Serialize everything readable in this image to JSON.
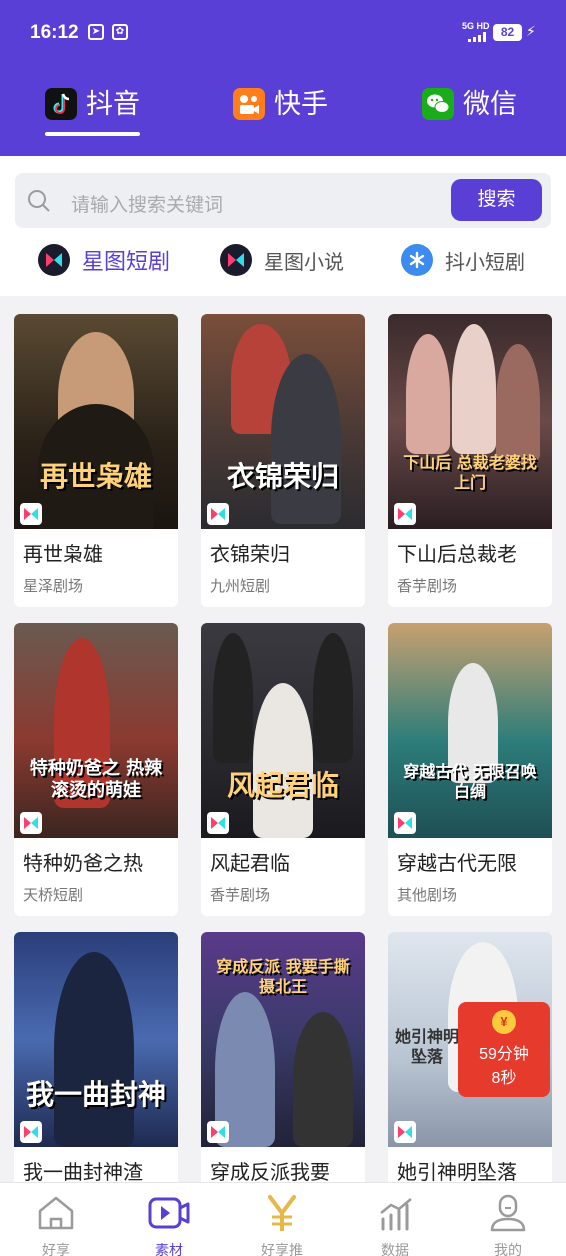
{
  "status_bar": {
    "time": "16:12",
    "network": "5G HD",
    "battery": "82",
    "icons": [
      "telegram-icon",
      "app-icon"
    ]
  },
  "platform_tabs": [
    {
      "label": "抖音",
      "icon": "douyin-icon",
      "active": true
    },
    {
      "label": "快手",
      "icon": "kuaishou-icon",
      "active": false
    },
    {
      "label": "微信",
      "icon": "wechat-icon",
      "active": false
    }
  ],
  "search": {
    "placeholder": "请输入搜索关键词",
    "button_label": "搜索"
  },
  "sub_tabs": [
    {
      "label": "星图短剧",
      "active": true
    },
    {
      "label": "星图小说",
      "active": false
    },
    {
      "label": "抖小短剧",
      "active": false
    }
  ],
  "cards": [
    {
      "title": "再世枭雄",
      "source": "星泽剧场",
      "poster_text": "再世枭雄"
    },
    {
      "title": "衣锦荣归",
      "source": "九州短剧",
      "poster_text": "衣锦荣归"
    },
    {
      "title": "下山后总裁老",
      "source": "香芋剧场",
      "poster_text": "下山后 总裁老婆找上门"
    },
    {
      "title": "特种奶爸之热",
      "source": "天桥短剧",
      "poster_text": "特种奶爸之 热辣滚烫的萌娃"
    },
    {
      "title": "风起君临",
      "source": "香芋剧场",
      "poster_text": "风起君临"
    },
    {
      "title": "穿越古代无限",
      "source": "其他剧场",
      "poster_text": "穿越古代 无限召唤白绸"
    },
    {
      "title": "我一曲封神渣",
      "source": "",
      "poster_text": "我一曲封神"
    },
    {
      "title": "穿成反派我要",
      "source": "",
      "poster_text": "穿成反派 我要手撕摄北王"
    },
    {
      "title": "她引神明坠落",
      "source": "",
      "poster_text": "她引神明坠落"
    }
  ],
  "red_packet": {
    "symbol": "¥",
    "line1": "59分钟",
    "line2": "8秒"
  },
  "bottom_nav": [
    {
      "label": "好享",
      "icon": "home-icon",
      "active": false
    },
    {
      "label": "素材",
      "icon": "video-icon",
      "active": true
    },
    {
      "label": "好享推",
      "icon": "yen-icon",
      "active": false
    },
    {
      "label": "数据",
      "icon": "chart-icon",
      "active": false
    },
    {
      "label": "我的",
      "icon": "profile-icon",
      "active": false
    }
  ],
  "colors": {
    "brand": "#5a3fd6",
    "background": "#f2f2f5"
  }
}
